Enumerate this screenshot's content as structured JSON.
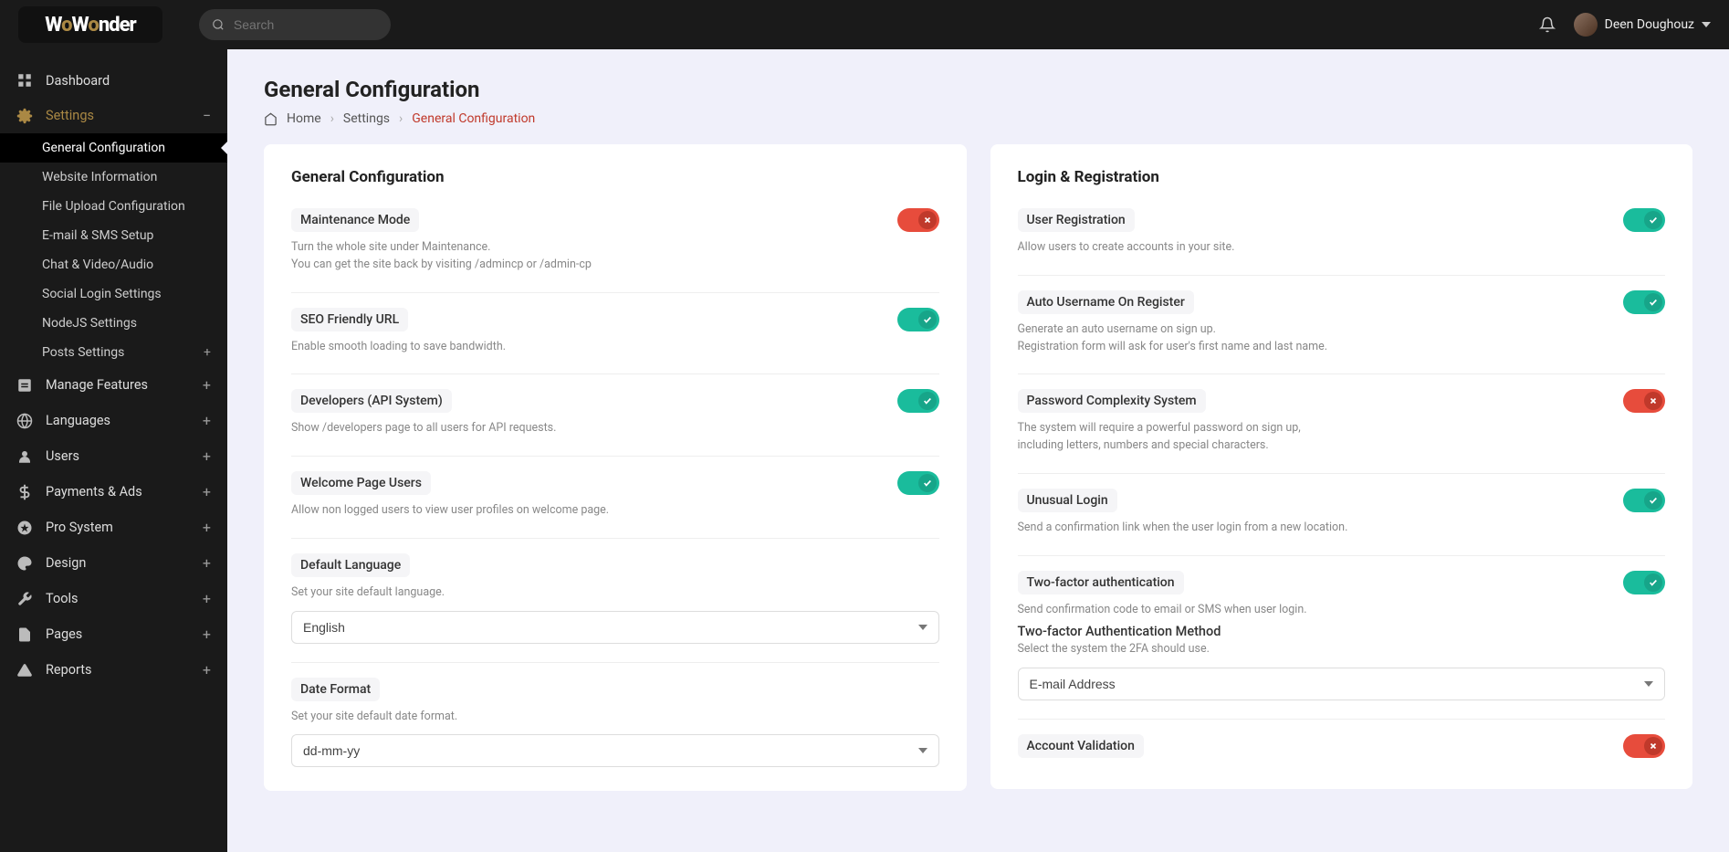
{
  "brand": "WoWonder",
  "search": {
    "placeholder": "Search"
  },
  "user": {
    "name": "Deen Doughouz"
  },
  "sidebar": {
    "items": [
      {
        "label": "Dashboard"
      },
      {
        "label": "Settings"
      }
    ],
    "settings_sub": [
      {
        "label": "General Configuration"
      },
      {
        "label": "Website Information"
      },
      {
        "label": "File Upload Configuration"
      },
      {
        "label": "E-mail & SMS Setup"
      },
      {
        "label": "Chat & Video/Audio"
      },
      {
        "label": "Social Login Settings"
      },
      {
        "label": "NodeJS Settings"
      },
      {
        "label": "Posts Settings"
      }
    ],
    "rest": [
      {
        "label": "Manage Features"
      },
      {
        "label": "Languages"
      },
      {
        "label": "Users"
      },
      {
        "label": "Payments & Ads"
      },
      {
        "label": "Pro System"
      },
      {
        "label": "Design"
      },
      {
        "label": "Tools"
      },
      {
        "label": "Pages"
      },
      {
        "label": "Reports"
      }
    ]
  },
  "page": {
    "title": "General Configuration",
    "breadcrumb": {
      "home": "Home",
      "settings": "Settings",
      "current": "General Configuration"
    }
  },
  "cards": {
    "general": {
      "title": "General Configuration",
      "maintenance": {
        "label": "Maintenance Mode",
        "desc1": "Turn the whole site under Maintenance.",
        "desc2": "You can get the site back by visiting /admincp or /admin-cp",
        "on": false
      },
      "seo": {
        "label": "SEO Friendly URL",
        "desc": "Enable smooth loading to save bandwidth.",
        "on": true
      },
      "developers": {
        "label": "Developers (API System)",
        "desc": "Show /developers page to all users for API requests.",
        "on": true
      },
      "welcome": {
        "label": "Welcome Page Users",
        "desc": "Allow non logged users to view user profiles on welcome page.",
        "on": true
      },
      "default_lang": {
        "label": "Default Language",
        "desc": "Set your site default language.",
        "value": "English"
      },
      "date_format": {
        "label": "Date Format",
        "desc": "Set your site default date format.",
        "value": "dd-mm-yy"
      }
    },
    "login": {
      "title": "Login & Registration",
      "user_reg": {
        "label": "User Registration",
        "desc": "Allow users to create accounts in your site.",
        "on": true
      },
      "auto_user": {
        "label": "Auto Username On Register",
        "desc1": "Generate an auto username on sign up.",
        "desc2": "Registration form will ask for user's first name and last name.",
        "on": true
      },
      "pw_complex": {
        "label": "Password Complexity System",
        "desc1": "The system will require a powerful password on sign up,",
        "desc2": "including letters, numbers and special characters.",
        "on": false
      },
      "unusual": {
        "label": "Unusual Login",
        "desc": "Send a confirmation link when the user login from a new location.",
        "on": true
      },
      "two_factor": {
        "label": "Two-factor authentication",
        "desc": "Send confirmation code to email or SMS when user login.",
        "on": true,
        "method_label": "Two-factor Authentication Method",
        "method_desc": "Select the system the 2FA should use.",
        "method_value": "E-mail Address"
      },
      "account_val": {
        "label": "Account Validation",
        "on": false
      }
    }
  }
}
